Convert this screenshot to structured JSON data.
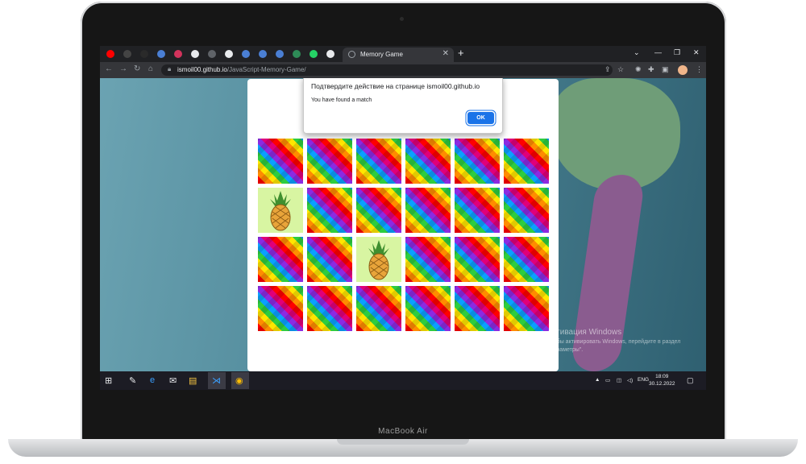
{
  "device": {
    "brand": "MacBook Air"
  },
  "browser": {
    "tabs": [
      {
        "icon": "youtube-icon",
        "color": "#ff0000"
      },
      {
        "icon": "m-icon",
        "color": "#444444"
      },
      {
        "icon": "dark-icon",
        "color": "#2a2a2a"
      },
      {
        "icon": "blue-c-icon",
        "color": "#4a7fd4"
      },
      {
        "icon": "pink-icon",
        "color": "#d2335c"
      },
      {
        "icon": "circle-icon",
        "color": "#e8eaed"
      },
      {
        "icon": "p-icon",
        "color": "#5f6368"
      },
      {
        "icon": "github-icon",
        "color": "#e8eaed"
      },
      {
        "icon": "blue-c-icon",
        "color": "#4a7fd4"
      },
      {
        "icon": "blue-c-icon",
        "color": "#4a7fd4"
      },
      {
        "icon": "blue-c-icon",
        "color": "#4a7fd4"
      },
      {
        "icon": "green-icon",
        "color": "#2e8b57"
      },
      {
        "icon": "whatsapp-icon",
        "color": "#25d366"
      },
      {
        "icon": "google-icon",
        "color": "#e8eaed"
      }
    ],
    "active_tab_title": "Memory Game",
    "url_host": "ismoil00.github.io",
    "url_path": "/JavaScript-Memory-Game/"
  },
  "dialog": {
    "title": "Подтвердите действие на странице ismoil00.github.io",
    "message": "You have found a match",
    "ok_label": "OK"
  },
  "game": {
    "grid": [
      [
        "down",
        "down",
        "down",
        "down",
        "down",
        "down"
      ],
      [
        "pineapple",
        "down",
        "down",
        "down",
        "down",
        "down"
      ],
      [
        "down",
        "down",
        "pineapple",
        "down",
        "down",
        "down"
      ],
      [
        "down",
        "down",
        "down",
        "down",
        "down",
        "down"
      ]
    ]
  },
  "watermark": {
    "title": "Активация Windows",
    "text": "Чтобы активировать Windows, перейдите в раздел \"Параметры\"."
  },
  "taskbar": {
    "lang": "ENG",
    "time": "18:09",
    "date": "30.12.2022"
  }
}
